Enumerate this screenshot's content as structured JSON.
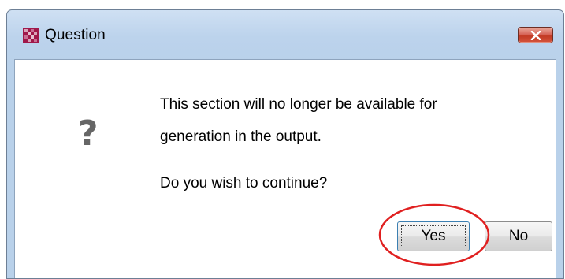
{
  "window": {
    "title": "Question",
    "app_icon": "app-logo-icon",
    "close_icon": "close-icon"
  },
  "dialog": {
    "icon": "question-mark-icon",
    "icon_glyph": "?",
    "message_line_1": "This section will no longer be available for",
    "message_line_2": "generation in the output.",
    "prompt": "Do you wish to continue?"
  },
  "buttons": {
    "yes_label": "Yes",
    "no_label": "No"
  },
  "annotation": {
    "color": "#e02020",
    "target": "yes-button"
  },
  "colors": {
    "titlebar": "#bcd3ec",
    "close_button": "#c23a24",
    "app_icon_primary": "#a0184a"
  }
}
